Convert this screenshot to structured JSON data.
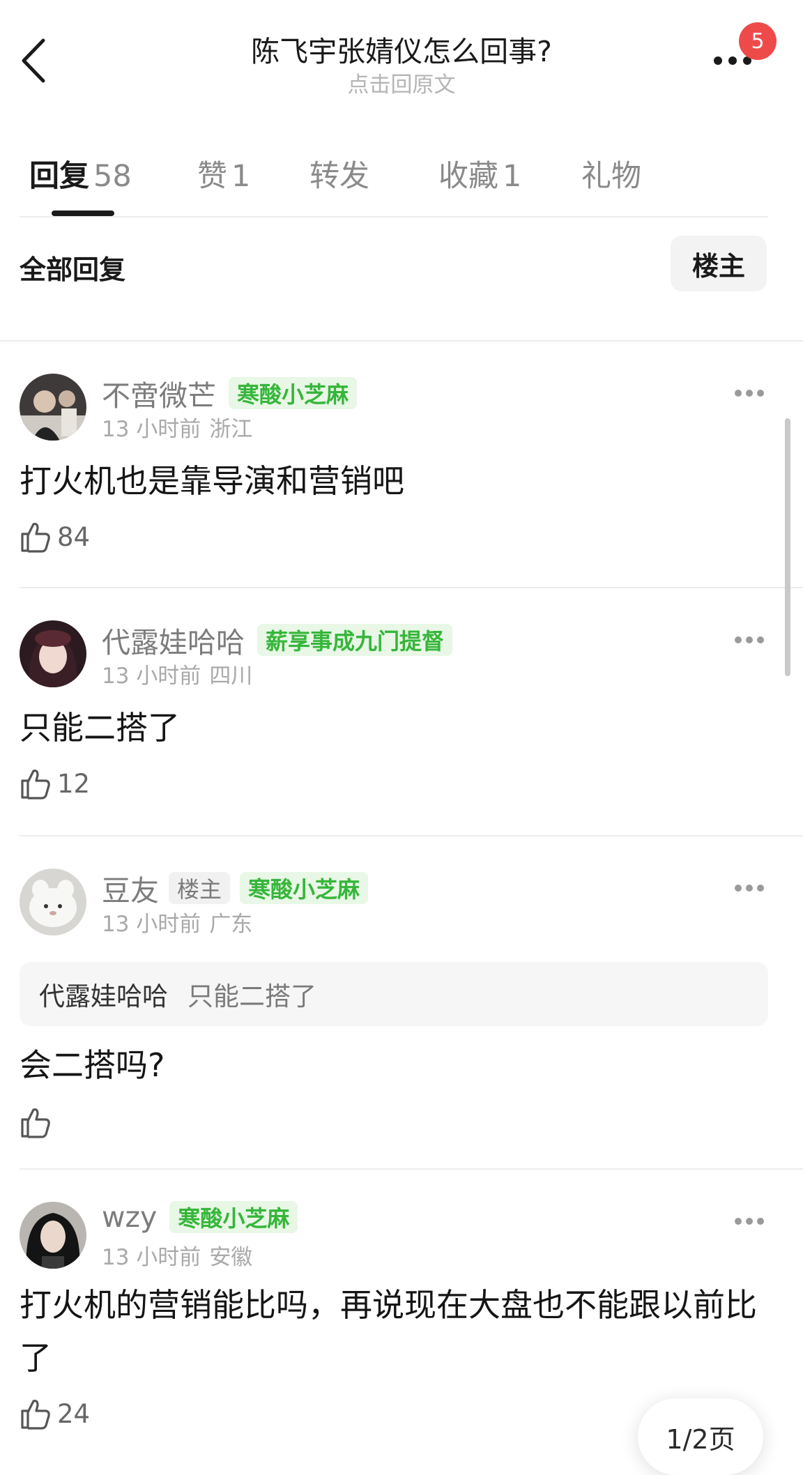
{
  "header": {
    "title": "陈飞宇张婧仪怎么回事?",
    "subtitle": "点击回原文",
    "badge_count": "5",
    "back_icon": "chevron-left-icon",
    "more_icon": "more-dots-icon"
  },
  "tabs": [
    {
      "label": "回复",
      "count": "58",
      "active": true
    },
    {
      "label": "赞",
      "count": "1"
    },
    {
      "label": "转发",
      "count": ""
    },
    {
      "label": "收藏",
      "count": "1"
    },
    {
      "label": "礼物",
      "count": ""
    }
  ],
  "filter": {
    "section_title": "全部回复",
    "op_button": "楼主"
  },
  "comments": [
    {
      "username": "不啻微芒",
      "op_tag": "",
      "group_tag": "寒酸小芝麻",
      "time": "13 小时前",
      "location": "浙江",
      "text": "打火机也是靠导演和营销吧",
      "likes": "84"
    },
    {
      "username": "代露娃哈哈",
      "op_tag": "",
      "group_tag": "薪享事成九门提督",
      "time": "13 小时前",
      "location": "四川",
      "text": "只能二搭了",
      "likes": "12"
    },
    {
      "username": "豆友",
      "op_tag": "楼主",
      "group_tag": "寒酸小芝麻",
      "time": "13 小时前",
      "location": "广东",
      "quote": {
        "name": "代露娃哈哈",
        "text": "只能二搭了"
      },
      "text": "会二搭吗?",
      "likes": ""
    },
    {
      "username": "wzy",
      "op_tag": "",
      "group_tag": "寒酸小芝麻",
      "time": "13 小时前",
      "location": "安徽",
      "text": "打火机的营销能比吗，再说现在大盘也不能跟以前比了",
      "likes": "24"
    }
  ],
  "pager": {
    "label": "1/2页"
  },
  "colors": {
    "accent_green": "#36b63a",
    "badge_red": "#ef4a4a",
    "text_gray": "#a9a9a9"
  }
}
